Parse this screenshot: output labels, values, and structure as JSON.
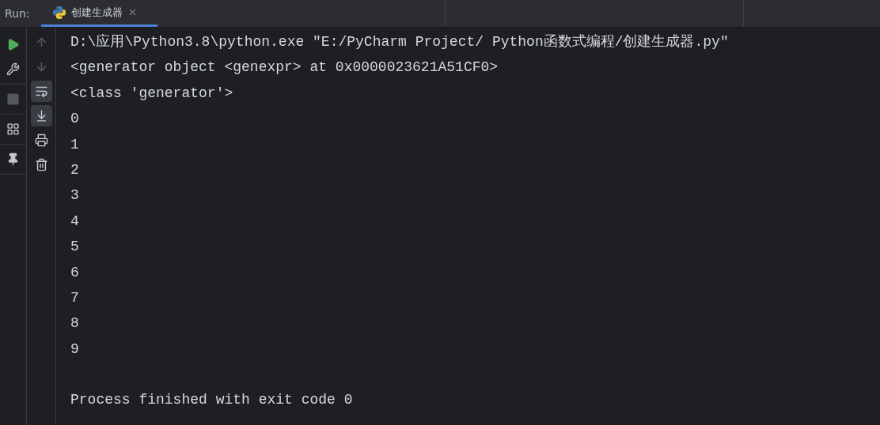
{
  "run_bar": {
    "label": "Run:",
    "tabs": [
      {
        "label": "创建生成器",
        "selected": true
      }
    ]
  },
  "left_toolbar": [
    [
      {
        "kind": "run",
        "disabled": false
      },
      {
        "kind": "settings",
        "disabled": false
      }
    ],
    [
      {
        "kind": "stop",
        "disabled": true
      }
    ],
    [
      {
        "kind": "layout",
        "disabled": false
      }
    ],
    [
      {
        "kind": "pin",
        "disabled": false
      }
    ]
  ],
  "side_toolbar": [
    {
      "kind": "up",
      "disabled": true,
      "selected": false
    },
    {
      "kind": "down",
      "disabled": true,
      "selected": false
    },
    {
      "kind": "wrap",
      "disabled": false,
      "selected": true
    },
    {
      "kind": "scroll_end",
      "disabled": false,
      "selected": true
    },
    {
      "kind": "print",
      "disabled": false,
      "selected": false
    },
    {
      "kind": "trash",
      "disabled": false,
      "selected": false
    }
  ],
  "console": {
    "lines": [
      "D:\\应用\\Python3.8\\python.exe \"E:/PyCharm Project/ Python函数式编程/创建生成器.py\"",
      "<generator object <genexpr> at 0x0000023621A51CF0>",
      "<class 'generator'>",
      "0",
      "1",
      "2",
      "3",
      "4",
      "5",
      "6",
      "7",
      "8",
      "9"
    ],
    "exit_message": "Process finished with exit code 0"
  }
}
